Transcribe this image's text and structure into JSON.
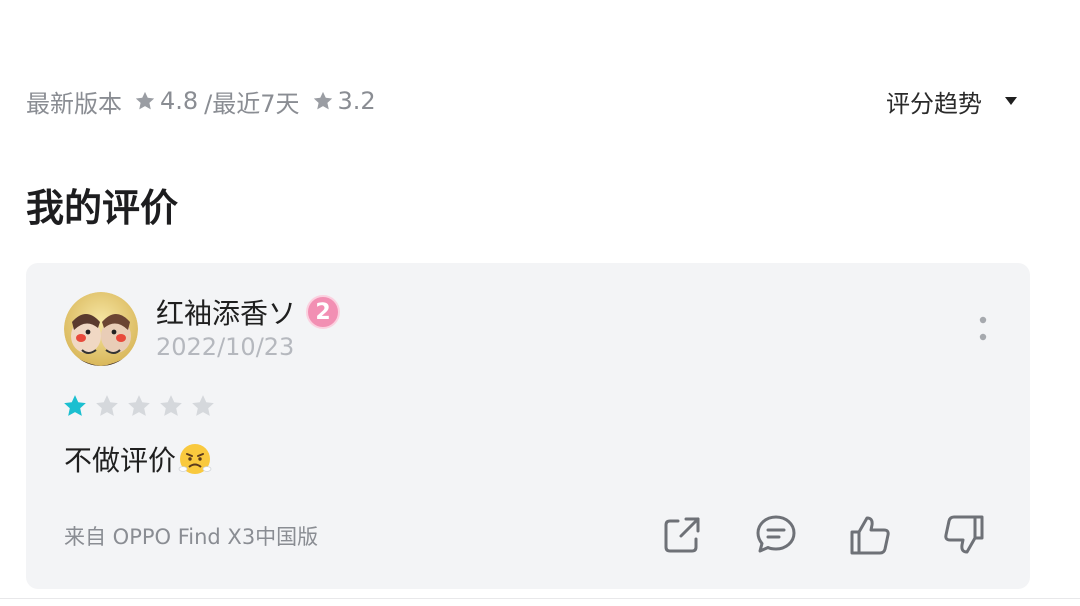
{
  "rating_summary": {
    "latest_label": "最新版本",
    "latest_score": "4.8",
    "separator_label": "/最近7天",
    "recent_score": "3.2",
    "star_icon": "star-icon"
  },
  "trend_dropdown": {
    "label": "评分趋势",
    "icon": "caret-down-icon"
  },
  "section_title": "我的评价",
  "review": {
    "user_name": "红袖添香ソ",
    "level_badge": "2",
    "date": "2022/10/23",
    "rating": 1,
    "rating_max": 5,
    "text": "不做评价",
    "emoji": "angry-face-emoji",
    "device": "来自 OPPO Find X3中国版",
    "actions": [
      "share-icon",
      "comment-icon",
      "thumbs-up-icon",
      "thumbs-down-icon"
    ]
  },
  "colors": {
    "star_filled": "#1bbfd0",
    "star_empty": "#d5d8dc",
    "card_bg": "#f3f4f6",
    "badge_pink": "#f28fb3",
    "muted_text": "#8a8d93"
  }
}
